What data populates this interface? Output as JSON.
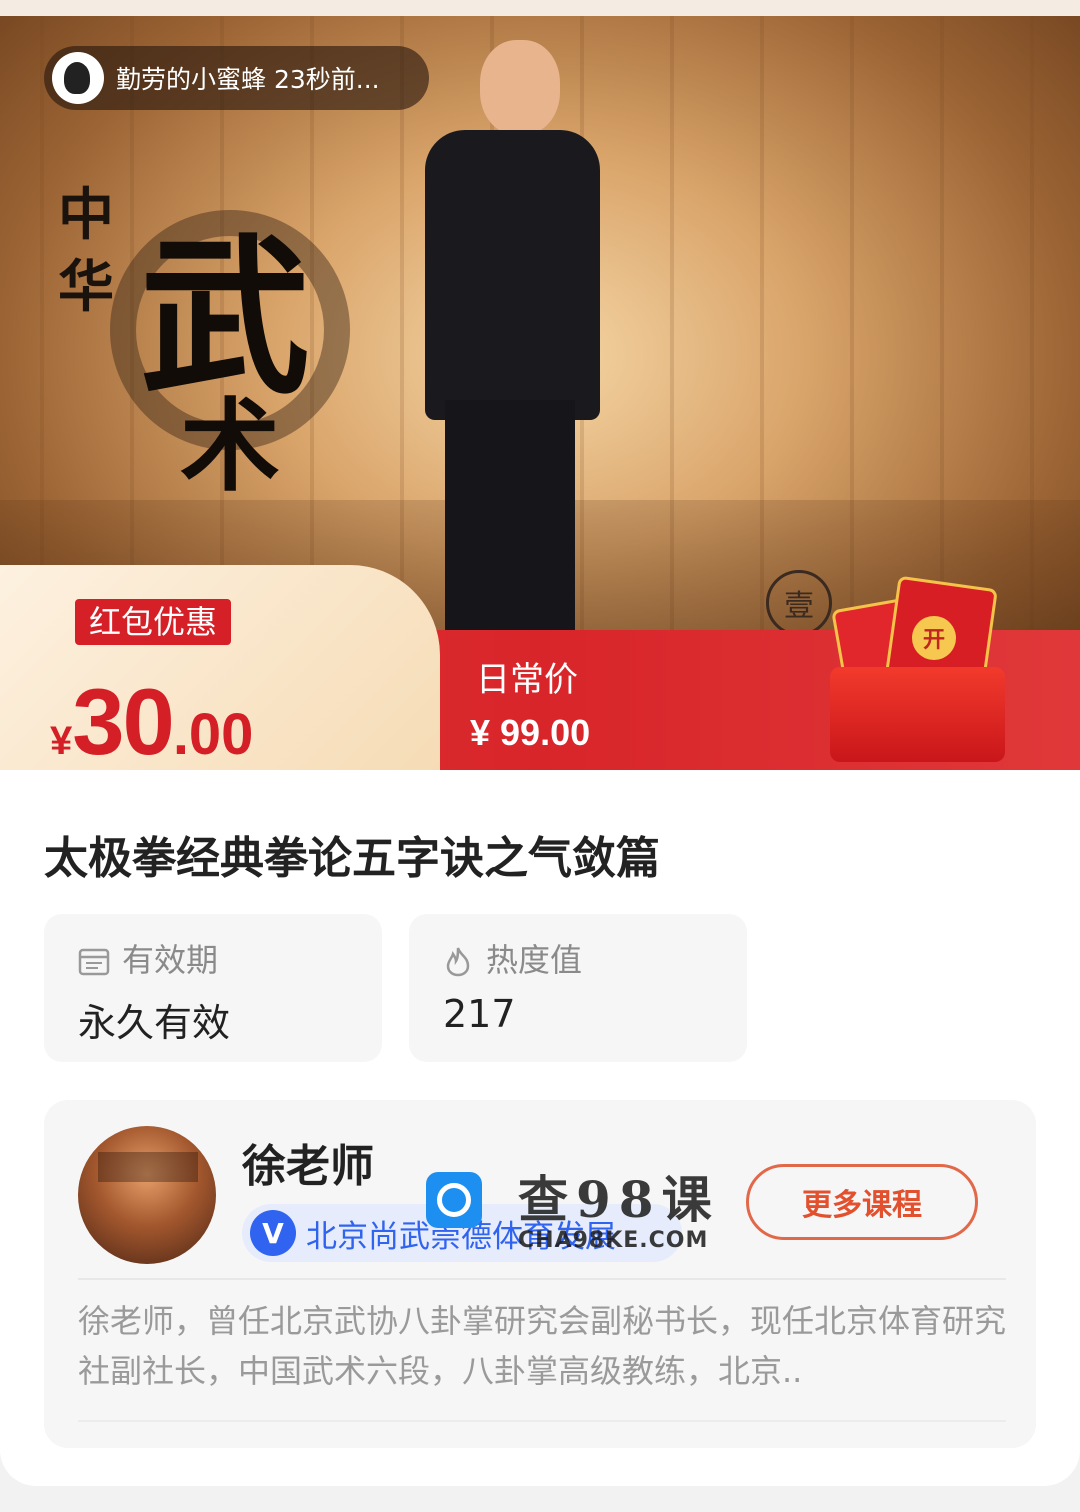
{
  "hero": {
    "user_activity": "勤劳的小蜜蜂 23秒前...",
    "calligraphy_small_1": "中",
    "calligraphy_small_2": "华",
    "calligraphy_big_1": "武",
    "calligraphy_big_2": "术",
    "seal_char": "壹"
  },
  "promo": {
    "tag": "红包优惠",
    "currency": "¥",
    "price_int": "30",
    "price_dec": ".00",
    "daily_label": "日常价",
    "daily_price": "¥ 99.00",
    "gift_coin": "开"
  },
  "course": {
    "title": "太极拳经典拳论五字诀之气敛篇",
    "validity_label": "有效期",
    "validity_value": "永久有效",
    "heat_label": "热度值",
    "heat_value": "217"
  },
  "teacher": {
    "name": "徐老师",
    "org_badge": "V",
    "org": "北京尚武崇德体育发展",
    "more_button": "更多课程",
    "description": "徐老师，曾任北京武协八卦掌研究会副秘书长，现任北京体育研究社副社长，中国武术六段，八卦掌高级教练，北京.."
  },
  "watermark": {
    "text": "查98课",
    "sub": "CHA98KE.COM"
  },
  "colors": {
    "promo_red": "#d42026",
    "accent_orange": "#e2502e",
    "org_blue": "#2f63f0"
  }
}
